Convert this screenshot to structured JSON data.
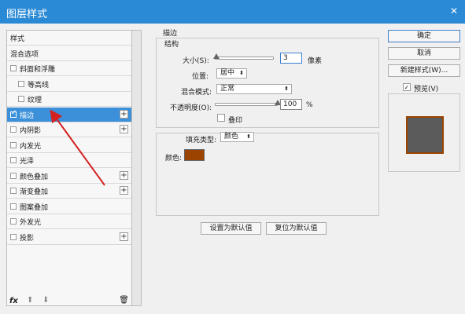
{
  "window": {
    "title": "图层样式",
    "close": "✕"
  },
  "left_panel": {
    "items": [
      {
        "label": "样式",
        "has_checkbox": false,
        "has_plus": false,
        "indent": false,
        "selected": false
      },
      {
        "label": "混合选项",
        "has_checkbox": false,
        "has_plus": false,
        "indent": false,
        "selected": false
      },
      {
        "label": "斜面和浮雕",
        "has_checkbox": true,
        "has_plus": false,
        "indent": false,
        "selected": false
      },
      {
        "label": "等高线",
        "has_checkbox": true,
        "has_plus": false,
        "indent": true,
        "selected": false
      },
      {
        "label": "纹理",
        "has_checkbox": true,
        "has_plus": false,
        "indent": true,
        "selected": false
      },
      {
        "label": "描边",
        "has_checkbox": true,
        "has_plus": true,
        "indent": false,
        "selected": true
      },
      {
        "label": "内阴影",
        "has_checkbox": true,
        "has_plus": true,
        "indent": false,
        "selected": false
      },
      {
        "label": "内发光",
        "has_checkbox": true,
        "has_plus": false,
        "indent": false,
        "selected": false
      },
      {
        "label": "光泽",
        "has_checkbox": true,
        "has_plus": false,
        "indent": false,
        "selected": false
      },
      {
        "label": "颜色叠加",
        "has_checkbox": true,
        "has_plus": true,
        "indent": false,
        "selected": false
      },
      {
        "label": "渐变叠加",
        "has_checkbox": true,
        "has_plus": true,
        "indent": false,
        "selected": false
      },
      {
        "label": "图案叠加",
        "has_checkbox": true,
        "has_plus": false,
        "indent": false,
        "selected": false
      },
      {
        "label": "外发光",
        "has_checkbox": true,
        "has_plus": false,
        "indent": false,
        "selected": false
      },
      {
        "label": "投影",
        "has_checkbox": true,
        "has_plus": true,
        "indent": false,
        "selected": false
      }
    ],
    "footer": {
      "fx": "fx",
      "up": "⬆",
      "down": "⬇",
      "trash": "🗑"
    }
  },
  "stroke": {
    "section_title": "描边",
    "structure_title": "结构",
    "size_label": "大小(S):",
    "size_value": "3",
    "size_unit": "像素",
    "position_label": "位置:",
    "position_value": "居中",
    "blend_label": "混合模式:",
    "blend_value": "正常",
    "opacity_label": "不透明度(O):",
    "opacity_value": "100",
    "opacity_unit": "%",
    "overprint_label": "叠印",
    "fill_type_label": "填充类型:",
    "fill_type_value": "颜色",
    "color_label": "颜色:",
    "color_hex": "#9a4400",
    "size_fraction": 0.03,
    "opacity_fraction": 1.0
  },
  "buttons": {
    "set_default": "设置为默认值",
    "reset_default": "复位为默认值",
    "ok": "确定",
    "cancel": "取消",
    "new_style": "新建样式(W)...",
    "preview_label": "预览(V)"
  },
  "colors": {
    "titlebar": "#2b8ad6",
    "selected": "#3b90d9",
    "arrow": "#d32020",
    "stroke": "#9a4400",
    "preview_fill": "#5b5b5b"
  }
}
